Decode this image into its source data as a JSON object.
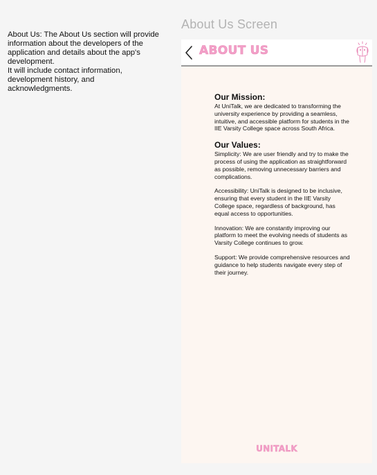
{
  "annotation": {
    "line1": "About Us: The About Us section will provide information about the developers of the application and details about the app's development.",
    "line2": "It will include contact information, development history, and acknowledgments."
  },
  "screen_label": "About Us Screen",
  "header": {
    "title": "ABOUT US",
    "back_icon": "chevron-left-icon",
    "mascot_icon": "mascot-icon"
  },
  "mission": {
    "heading": "Our Mission:",
    "text": "At UniTalk, we are dedicated to transforming the university experience by providing a seamless, intuitive, and accessible platform for students in the IIE Varsity College space across South Africa."
  },
  "values": {
    "heading": "Our Values:",
    "items": [
      {
        "name": "Simplicity",
        "text": ": We are user friendly and try to make the process of using the application as straightforward as possible, removing unnecessary barriers and complications."
      },
      {
        "name": "",
        "text": "Accessibility: UniTalk is designed to be inclusive, ensuring that every student in the IIE Varsity College space, regardless of background, has equal access to opportunities."
      },
      {
        "name": "",
        "text": "Innovation: We are constantly improving our platform to meet the evolving needs of students as Varsity College continues to grow."
      },
      {
        "name": "",
        "text": "Support: We provide comprehensive resources and guidance to help students navigate every step of their journey."
      }
    ]
  },
  "footer": {
    "logo": "UNITALK"
  },
  "colors": {
    "accent_pink": "#f3a0c8",
    "screen_bg": "#fdf6f1",
    "page_bg": "#f5f5f5"
  }
}
